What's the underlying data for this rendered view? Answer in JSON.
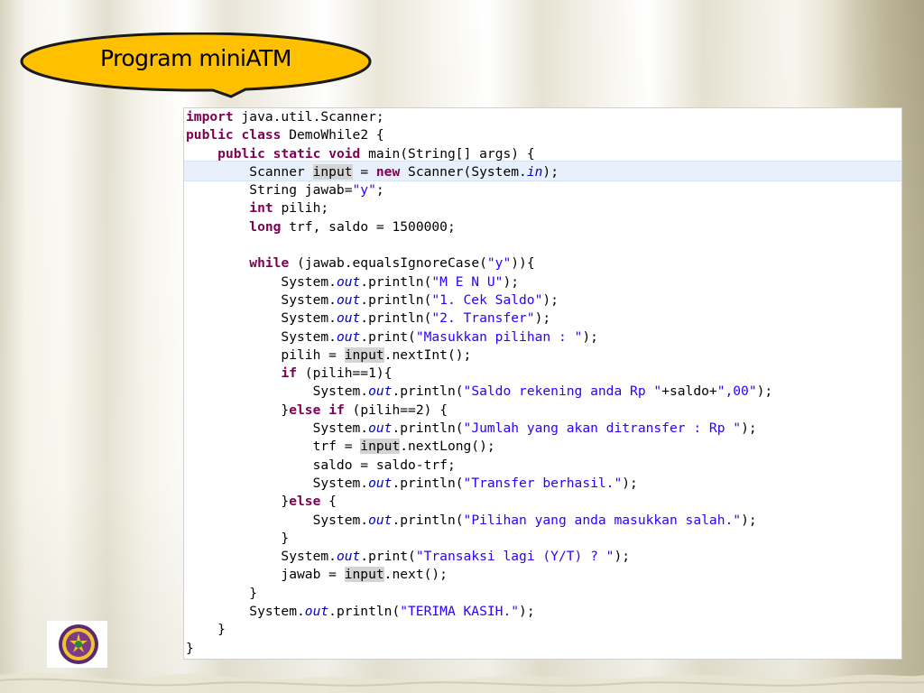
{
  "slide": {
    "title": "Program miniATM"
  },
  "colors": {
    "bubble_fill": "#ffc000",
    "bubble_stroke": "#1a1a1a",
    "keyword": "#7f0055",
    "string": "#2a00ff",
    "field": "#0000c0",
    "current_line_highlight": "#e8f0fb",
    "occurrence_highlight": "#d4d4d4"
  },
  "icons": {
    "emblem": "university-emblem-icon"
  },
  "code": {
    "language": "java",
    "lines": [
      [
        {
          "t": "import",
          "c": "kw"
        },
        {
          "t": " java.util.Scanner;"
        }
      ],
      [
        {
          "t": "public",
          "c": "kw"
        },
        {
          "t": " "
        },
        {
          "t": "class",
          "c": "kw"
        },
        {
          "t": " DemoWhile2 {"
        }
      ],
      [
        {
          "t": "    "
        },
        {
          "t": "public",
          "c": "kw"
        },
        {
          "t": " "
        },
        {
          "t": "static",
          "c": "kw"
        },
        {
          "t": " "
        },
        {
          "t": "void",
          "c": "kw"
        },
        {
          "t": " main(String[] args) {"
        }
      ],
      [
        {
          "t": "        Scanner "
        },
        {
          "t": "input",
          "c": "hl"
        },
        {
          "t": " = "
        },
        {
          "t": "new",
          "c": "kw"
        },
        {
          "t": " Scanner(System."
        },
        {
          "t": "in",
          "c": "fld"
        },
        {
          "t": ");"
        }
      ],
      [
        {
          "t": "        String jawab="
        },
        {
          "t": "\"y\"",
          "c": "str"
        },
        {
          "t": ";"
        }
      ],
      [
        {
          "t": "        "
        },
        {
          "t": "int",
          "c": "kw"
        },
        {
          "t": " pilih;"
        }
      ],
      [
        {
          "t": "        "
        },
        {
          "t": "long",
          "c": "kw"
        },
        {
          "t": " trf, saldo = 1500000;"
        }
      ],
      [
        {
          "t": ""
        }
      ],
      [
        {
          "t": "        "
        },
        {
          "t": "while",
          "c": "kw"
        },
        {
          "t": " (jawab.equalsIgnoreCase("
        },
        {
          "t": "\"y\"",
          "c": "str"
        },
        {
          "t": ")){"
        }
      ],
      [
        {
          "t": "            System."
        },
        {
          "t": "out",
          "c": "fld"
        },
        {
          "t": ".println("
        },
        {
          "t": "\"M E N U\"",
          "c": "str"
        },
        {
          "t": ");"
        }
      ],
      [
        {
          "t": "            System."
        },
        {
          "t": "out",
          "c": "fld"
        },
        {
          "t": ".println("
        },
        {
          "t": "\"1. Cek Saldo\"",
          "c": "str"
        },
        {
          "t": ");"
        }
      ],
      [
        {
          "t": "            System."
        },
        {
          "t": "out",
          "c": "fld"
        },
        {
          "t": ".println("
        },
        {
          "t": "\"2. Transfer\"",
          "c": "str"
        },
        {
          "t": ");"
        }
      ],
      [
        {
          "t": "            System."
        },
        {
          "t": "out",
          "c": "fld"
        },
        {
          "t": ".print("
        },
        {
          "t": "\"Masukkan pilihan : \"",
          "c": "str"
        },
        {
          "t": ");"
        }
      ],
      [
        {
          "t": "            pilih = "
        },
        {
          "t": "input",
          "c": "hl"
        },
        {
          "t": ".nextInt();"
        }
      ],
      [
        {
          "t": "            "
        },
        {
          "t": "if",
          "c": "kw"
        },
        {
          "t": " (pilih==1){"
        }
      ],
      [
        {
          "t": "                System."
        },
        {
          "t": "out",
          "c": "fld"
        },
        {
          "t": ".println("
        },
        {
          "t": "\"Saldo rekening anda Rp \"",
          "c": "str"
        },
        {
          "t": "+saldo+"
        },
        {
          "t": "\",00\"",
          "c": "str"
        },
        {
          "t": ");"
        }
      ],
      [
        {
          "t": "            }"
        },
        {
          "t": "else",
          "c": "kw"
        },
        {
          "t": " "
        },
        {
          "t": "if",
          "c": "kw"
        },
        {
          "t": " (pilih==2) {"
        }
      ],
      [
        {
          "t": "                System."
        },
        {
          "t": "out",
          "c": "fld"
        },
        {
          "t": ".println("
        },
        {
          "t": "\"Jumlah yang akan ditransfer : Rp \"",
          "c": "str"
        },
        {
          "t": ");"
        }
      ],
      [
        {
          "t": "                trf = "
        },
        {
          "t": "input",
          "c": "hl"
        },
        {
          "t": ".nextLong();"
        }
      ],
      [
        {
          "t": "                saldo = saldo-trf;"
        }
      ],
      [
        {
          "t": "                System."
        },
        {
          "t": "out",
          "c": "fld"
        },
        {
          "t": ".println("
        },
        {
          "t": "\"Transfer berhasil.\"",
          "c": "str"
        },
        {
          "t": ");"
        }
      ],
      [
        {
          "t": "            }"
        },
        {
          "t": "else",
          "c": "kw"
        },
        {
          "t": " {"
        }
      ],
      [
        {
          "t": "                System."
        },
        {
          "t": "out",
          "c": "fld"
        },
        {
          "t": ".println("
        },
        {
          "t": "\"Pilihan yang anda masukkan salah.\"",
          "c": "str"
        },
        {
          "t": ");"
        }
      ],
      [
        {
          "t": "            }"
        }
      ],
      [
        {
          "t": "            System."
        },
        {
          "t": "out",
          "c": "fld"
        },
        {
          "t": ".print("
        },
        {
          "t": "\"Transaksi lagi (Y/T) ? \"",
          "c": "str"
        },
        {
          "t": ");"
        }
      ],
      [
        {
          "t": "            jawab = "
        },
        {
          "t": "input",
          "c": "hl"
        },
        {
          "t": ".next();"
        }
      ],
      [
        {
          "t": "        }"
        }
      ],
      [
        {
          "t": "        System."
        },
        {
          "t": "out",
          "c": "fld"
        },
        {
          "t": ".println("
        },
        {
          "t": "\"TERIMA KASIH.\"",
          "c": "str"
        },
        {
          "t": ");"
        }
      ],
      [
        {
          "t": "    }"
        }
      ],
      [
        {
          "t": "}"
        }
      ]
    ]
  }
}
